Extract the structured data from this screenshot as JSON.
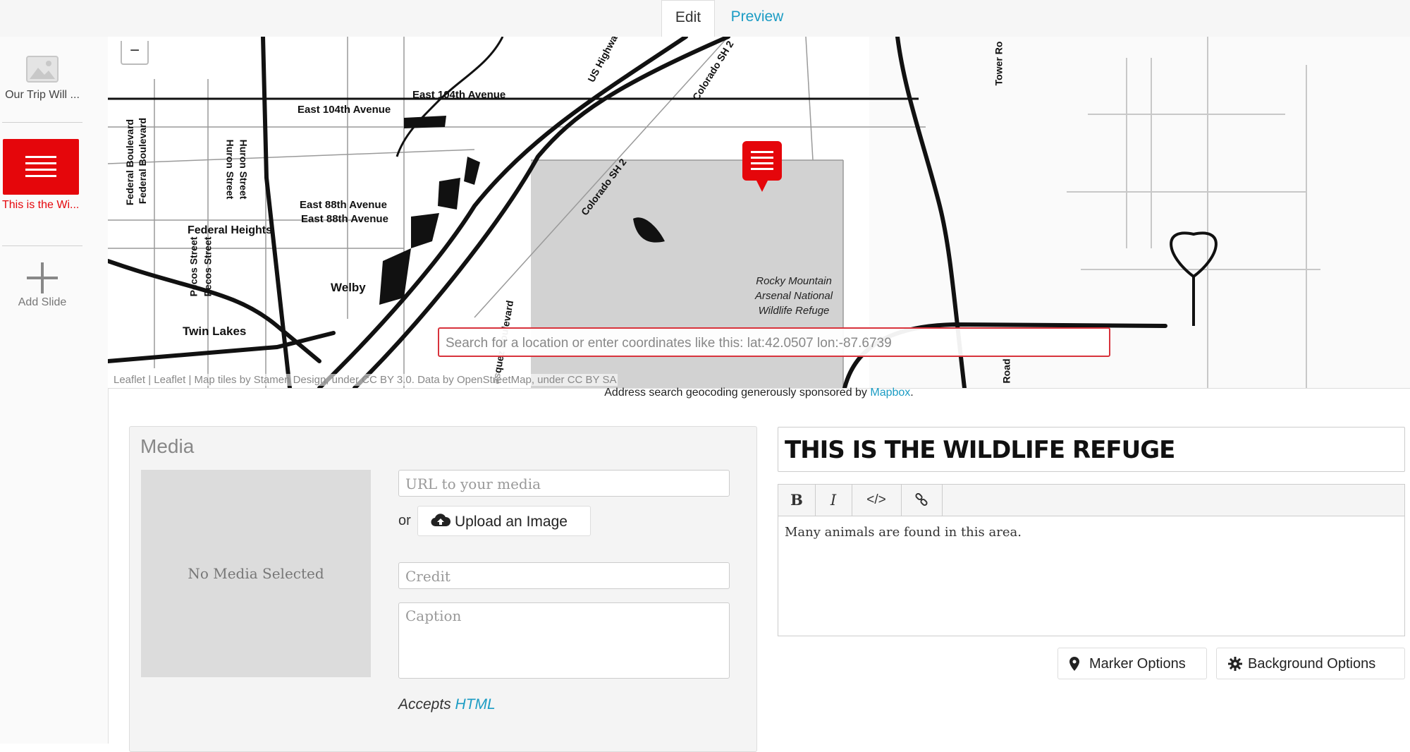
{
  "tabs": {
    "edit": "Edit",
    "preview": "Preview"
  },
  "sidebar": {
    "slides": [
      {
        "label": "Our Trip Will ..."
      },
      {
        "label": "This is the Wi..."
      }
    ],
    "add_label": "Add Slide"
  },
  "map": {
    "zoom_minus": "−",
    "labels": {
      "east_104th_a": "East 104th Avenue",
      "east_104th_b": "East 104th Avenue",
      "east_88th_a": "East 88th Avenue",
      "east_88th_b": "East 88th Avenue",
      "federal_heights": "Federal Heights",
      "welby": "Welby",
      "twin_lakes": "Twin Lakes",
      "federal_blvd_a": "Federal Boulevard",
      "federal_blvd_b": "Federal Boulevard",
      "huron_a": "Huron Street",
      "huron_b": "Huron Street",
      "pecos_a": "Pecos Street",
      "pecos_b": "Pecos Street",
      "colorado_sh2_a": "Colorado SH 2",
      "colorado_sh2_b": "Colorado SH 2",
      "us_highway": "US Highwa",
      "tower_road": "Tower Ro",
      "road": "Road",
      "boulevard": "asquez Boulevard",
      "refuge_1": "Rocky Mountain",
      "refuge_2": "Arsenal National",
      "refuge_3": "Wildlife Refuge"
    },
    "search_placeholder": "Search for a location or enter coordinates like this: lat:42.0507 lon:-87.6739",
    "attribution": "Leaflet | Leaflet | Map tiles by Stamen Design, under CC BY 3.0. Data by OpenStreetMap, under CC BY SA"
  },
  "geocode": {
    "text": "Address search geocoding generously sponsored by ",
    "link": "Mapbox",
    "end": "."
  },
  "media": {
    "title": "Media",
    "no_media": "No Media Selected",
    "url_placeholder": "URL to your media",
    "or": "or",
    "upload": "Upload an Image",
    "credit_placeholder": "Credit",
    "caption_placeholder": "Caption",
    "accepts": "Accepts ",
    "accepts_link": "HTML"
  },
  "text": {
    "headline": "THIS IS THE WILDLIFE REFUGE",
    "body": "Many animals are found in this area.",
    "toolbar": {
      "bold": "B",
      "italic": "I",
      "code": "</>"
    }
  },
  "options": {
    "marker": "Marker Options",
    "background": "Background Options"
  },
  "colors": {
    "accent": "#e5060b",
    "link": "#1b9cc4"
  }
}
